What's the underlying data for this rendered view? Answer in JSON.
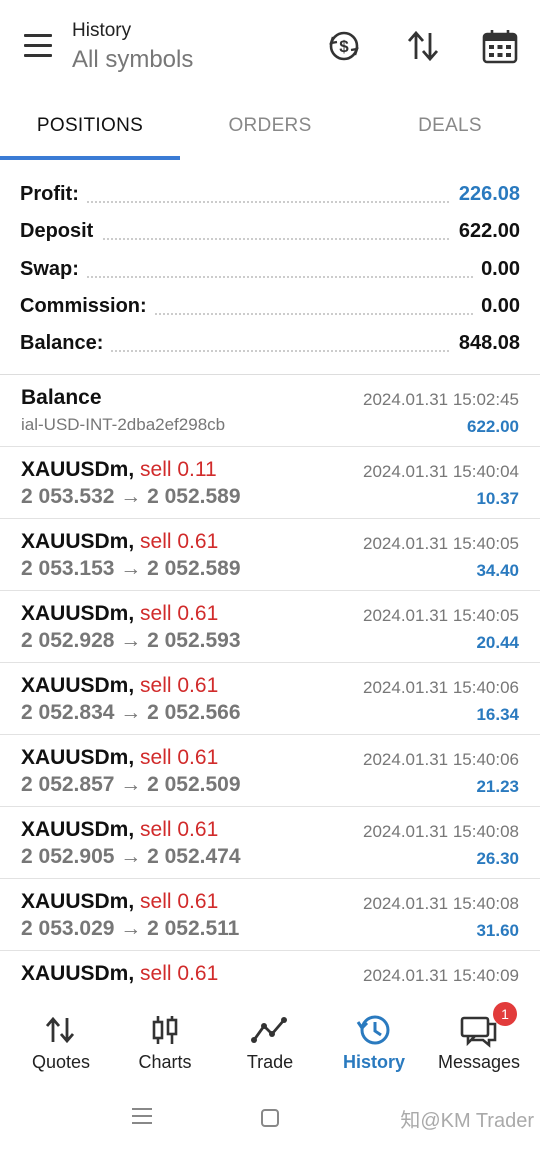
{
  "header": {
    "title": "History",
    "subtitle": "All symbols"
  },
  "tabs": [
    {
      "label": "POSITIONS",
      "active": true
    },
    {
      "label": "ORDERS",
      "active": false
    },
    {
      "label": "DEALS",
      "active": false
    }
  ],
  "summary": {
    "profit": {
      "label": "Profit:",
      "value": "226.08"
    },
    "deposit": {
      "label": "Deposit",
      "value": "622.00"
    },
    "swap": {
      "label": "Swap:",
      "value": "0.00"
    },
    "commission": {
      "label": "Commission:",
      "value": "0.00"
    },
    "balance": {
      "label": "Balance:",
      "value": "848.08"
    }
  },
  "balance_entry": {
    "title": "Balance",
    "comment": "ial-USD-INT-2dba2ef298cb",
    "time": "2024.01.31 15:02:45",
    "amount": "622.00"
  },
  "deals": [
    {
      "symbol": "XAUUSDm,",
      "side": "sell 0.11",
      "prices": "2 053.532 → 2 052.589",
      "time": "2024.01.31 15:40:04",
      "profit": "10.37"
    },
    {
      "symbol": "XAUUSDm,",
      "side": "sell 0.61",
      "prices": "2 053.153 → 2 052.589",
      "time": "2024.01.31 15:40:05",
      "profit": "34.40"
    },
    {
      "symbol": "XAUUSDm,",
      "side": "sell 0.61",
      "prices": "2 052.928 → 2 052.593",
      "time": "2024.01.31 15:40:05",
      "profit": "20.44"
    },
    {
      "symbol": "XAUUSDm,",
      "side": "sell 0.61",
      "prices": "2 052.834 → 2 052.566",
      "time": "2024.01.31 15:40:06",
      "profit": "16.34"
    },
    {
      "symbol": "XAUUSDm,",
      "side": "sell 0.61",
      "prices": "2 052.857 → 2 052.509",
      "time": "2024.01.31 15:40:06",
      "profit": "21.23"
    },
    {
      "symbol": "XAUUSDm,",
      "side": "sell 0.61",
      "prices": "2 052.905 → 2 052.474",
      "time": "2024.01.31 15:40:08",
      "profit": "26.30"
    },
    {
      "symbol": "XAUUSDm,",
      "side": "sell 0.61",
      "prices": "2 053.029 → 2 052.511",
      "time": "2024.01.31 15:40:08",
      "profit": "31.60"
    },
    {
      "symbol": "XAUUSDm,",
      "side": "sell 0.61",
      "prices": "",
      "time": "2024.01.31 15:40:09",
      "profit": ""
    }
  ],
  "nav": [
    {
      "label": "Quotes",
      "icon": "quotes-icon",
      "active": false
    },
    {
      "label": "Charts",
      "icon": "charts-icon",
      "active": false
    },
    {
      "label": "Trade",
      "icon": "trade-icon",
      "active": false
    },
    {
      "label": "History",
      "icon": "history-icon",
      "active": true
    },
    {
      "label": "Messages",
      "icon": "messages-icon",
      "active": false,
      "badge": "1"
    }
  ],
  "watermark": "知@KM Trader",
  "colors": {
    "accent": "#2a7abf",
    "sell": "#d12b2b",
    "badge": "#e23b3b"
  }
}
